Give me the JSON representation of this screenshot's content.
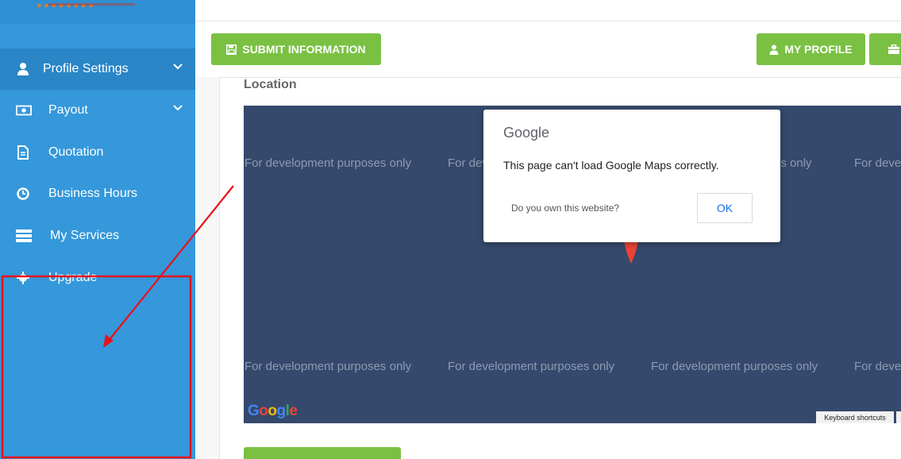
{
  "sidebar": {
    "logo_text": "........",
    "items": [
      {
        "label": "Profile Settings",
        "icon": "user-icon",
        "has_chevron": true
      },
      {
        "label": "Payout",
        "icon": "money-icon",
        "has_chevron": true
      },
      {
        "label": "Quotation",
        "icon": "document-icon",
        "has_chevron": false
      },
      {
        "label": "Business Hours",
        "icon": "clock-icon",
        "has_chevron": false
      },
      {
        "label": "My Services",
        "icon": "server-icon",
        "has_chevron": false
      },
      {
        "label": "Upgrade",
        "icon": "gear-icon",
        "has_chevron": false
      }
    ]
  },
  "toolbar": {
    "submit_label": "SUBMIT INFORMATION",
    "profile_label": "MY PROFILE"
  },
  "location": {
    "label": "Location"
  },
  "map": {
    "watermark": "For development purposes only",
    "watermark_short": "For dev",
    "watermark_short2": "For deve",
    "watermark_end": "es only",
    "keyboard_shortcuts": "Keyboard shortcuts",
    "logo": "Google"
  },
  "dialog": {
    "title": "Google",
    "message": "This page can't load Google Maps correctly.",
    "question": "Do you own this website?",
    "ok_label": "OK"
  },
  "colors": {
    "sidebar": "#3498db",
    "button": "#7ac143",
    "map": "#35496c",
    "annotation": "#e8121a"
  }
}
